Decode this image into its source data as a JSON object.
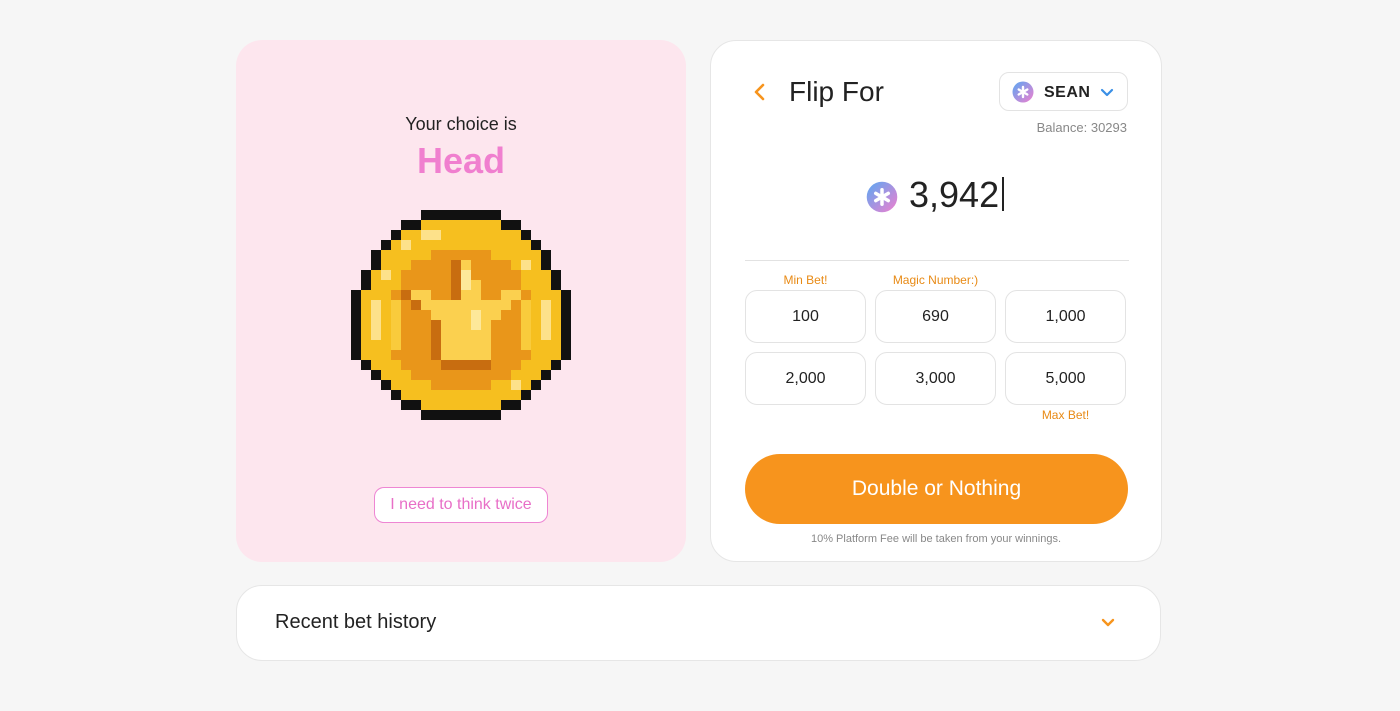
{
  "choice": {
    "caption": "Your choice is",
    "value": "Head",
    "rethink_label": "I need to think twice",
    "coin_icon": "pixel-star-coin-icon"
  },
  "bet": {
    "title": "Flip For",
    "token": {
      "name": "SEAN",
      "icon": "sean-token-icon"
    },
    "balance_text": "Balance: 30293",
    "amount": "3,942",
    "hints": {
      "min": "Min Bet!",
      "magic": "Magic Number:)",
      "max": "Max Bet!"
    },
    "presets": [
      "100",
      "690",
      "1,000",
      "2,000",
      "3,000",
      "5,000"
    ],
    "cta_label": "Double or Nothing",
    "fee_note": "10% Platform Fee will be taken from your winnings."
  },
  "history": {
    "title": "Recent bet history"
  },
  "colors": {
    "accent_orange": "#f7941d",
    "pink": "#f07fcf",
    "pink_bg": "#fde6ee",
    "token_gradient": [
      "#5aa8f2",
      "#f07fcf"
    ]
  }
}
